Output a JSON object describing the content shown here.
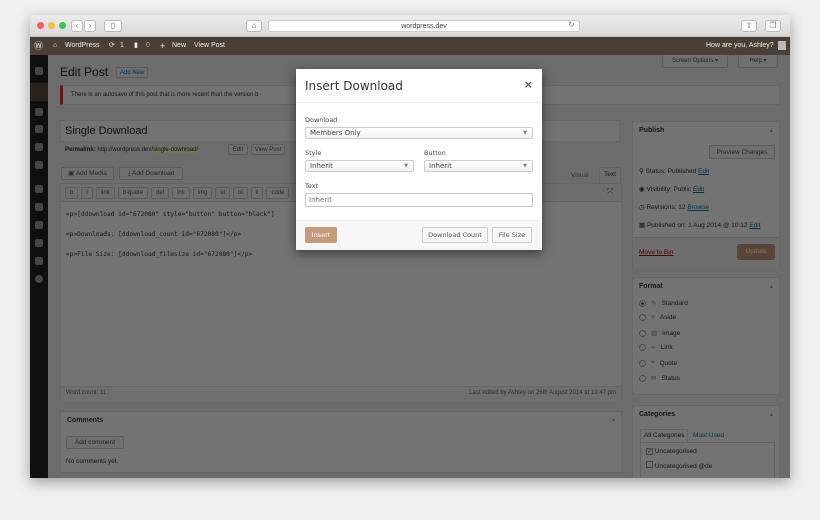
{
  "browser": {
    "url": "wordpress.dev",
    "back": "‹",
    "forward": "›"
  },
  "adminbar": {
    "site": "WordPress",
    "updates": "1",
    "comments": "0",
    "new": "New",
    "view_post": "View Post",
    "greeting": "How are you, Ashley?"
  },
  "header": {
    "title": "Edit Post",
    "add_new": "Add New",
    "screen_options": "Screen Options ▾",
    "help": "Help ▾"
  },
  "notice": "There is an autosave of this post that is more recent than the version b",
  "post": {
    "title": "Single Download",
    "permalink_label": "Permalink:",
    "permalink_base": "http://wordpress.dev/",
    "permalink_slug": "single-download/",
    "edit": "Edit",
    "view_post": "View Post"
  },
  "editor": {
    "add_media": "Add Media",
    "add_download": "Add Download",
    "tab_visual": "Visual",
    "tab_text": "Text",
    "quicktags": [
      "b",
      "i",
      "link",
      "b-quote",
      "del",
      "ins",
      "img",
      "ul",
      "ol",
      "li",
      "code"
    ],
    "lines": [
      "<p>[ddownload id=\"672080\" style=\"button\" button=\"black\"]",
      "<p>Downloads: [ddownload_count id=\"672080\"]</p>",
      "<p>File Size: [ddownload_filesize id=\"672080\"]</p>"
    ],
    "word_count": "Word count: 11",
    "last_edited": "Last edited by Ashley on 26th August 2014 at 12:47 pm"
  },
  "comments": {
    "title": "Comments",
    "add": "Add comment",
    "none": "No comments yet."
  },
  "publish": {
    "title": "Publish",
    "preview": "Preview Changes",
    "status": "Status: Published",
    "visibility": "Visibility: Public",
    "revisions": "Revisions: 12",
    "browse": "Browse",
    "published_on": "Published on: 1 Aug 2014 @ 10:12",
    "edit": "Edit",
    "move_to_bin": "Move to Bin",
    "update": "Update"
  },
  "format": {
    "title": "Format",
    "options": [
      "Standard",
      "Aside",
      "Image",
      "Link",
      "Quote",
      "Status"
    ],
    "selected": "Standard"
  },
  "categories": {
    "title": "Categories",
    "tab_all": "All Categories",
    "tab_most": "Most Used",
    "items": [
      {
        "label": "Uncategorised",
        "checked": true
      },
      {
        "label": "Uncategorised @de",
        "checked": false
      }
    ]
  },
  "modal": {
    "title": "Insert Download",
    "close": "×",
    "download_label": "Download",
    "download_value": "Members Only",
    "style_label": "Style",
    "style_value": "Inherit",
    "button_label": "Button",
    "button_value": "Inherit",
    "text_label": "Text",
    "text_placeholder": "Inherit",
    "insert": "Insert",
    "download_count": "Download Count",
    "file_size": "File Size"
  },
  "colors": {
    "admin_bar": "#4a3f36",
    "insert_button": "#c49a7a",
    "move_to_bin": "#a00"
  }
}
